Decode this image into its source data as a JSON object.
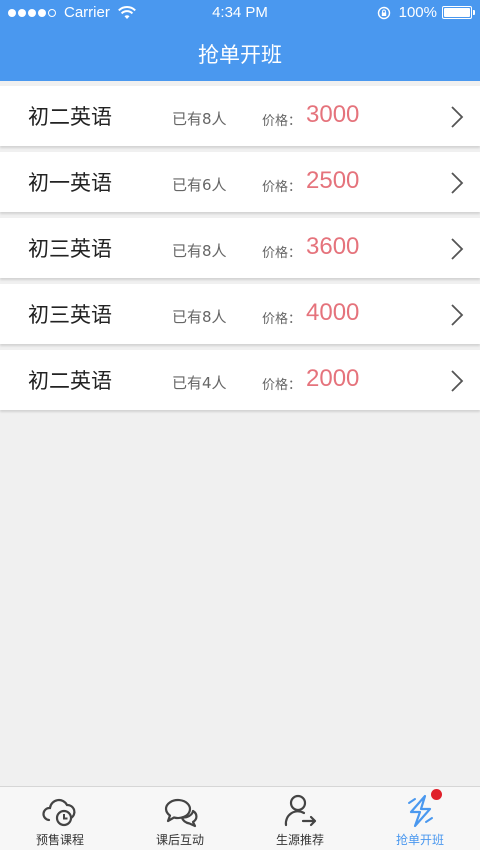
{
  "status_bar": {
    "carrier": "Carrier",
    "time": "4:34 PM",
    "battery": "100%"
  },
  "header": {
    "title": "抢单开班"
  },
  "courses": [
    {
      "name": "初二英语",
      "enrolled": "已有8人",
      "price_label": "价格：",
      "price": "3000"
    },
    {
      "name": "初一英语",
      "enrolled": "已有6人",
      "price_label": "价格：",
      "price": "2500"
    },
    {
      "name": "初三英语",
      "enrolled": "已有8人",
      "price_label": "价格：",
      "price": "3600"
    },
    {
      "name": "初三英语",
      "enrolled": "已有8人",
      "price_label": "价格：",
      "price": "4000"
    },
    {
      "name": "初二英语",
      "enrolled": "已有4人",
      "price_label": "价格：",
      "price": "2000"
    }
  ],
  "tabs": [
    {
      "label": "预售课程",
      "icon": "cloud-clock-icon"
    },
    {
      "label": "课后互动",
      "icon": "chat-bubbles-icon"
    },
    {
      "label": "生源推荐",
      "icon": "user-arrow-icon"
    },
    {
      "label": "抢单开班",
      "icon": "lightning-icon"
    }
  ],
  "colors": {
    "accent": "#4a98ef",
    "price": "#e5737c",
    "badge": "#e0202a"
  }
}
